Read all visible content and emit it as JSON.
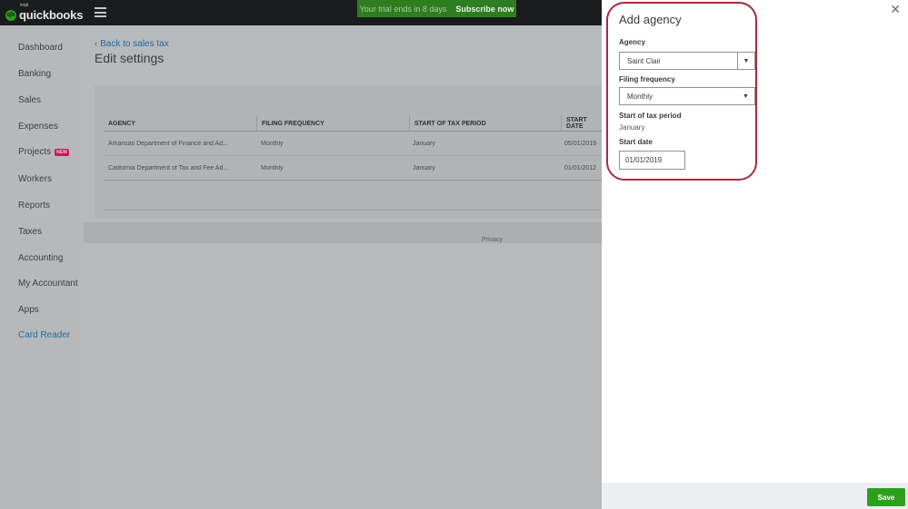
{
  "topbar": {
    "brand_small": "intuit",
    "brand": "quickbooks",
    "trial_text": "Your trial ends in 8 days",
    "subscribe_label": "Subscribe now"
  },
  "sidebar": {
    "items": [
      {
        "label": "Dashboard"
      },
      {
        "label": "Banking"
      },
      {
        "label": "Sales"
      },
      {
        "label": "Expenses"
      },
      {
        "label": "Projects",
        "badge": "NEW"
      },
      {
        "label": "Workers"
      },
      {
        "label": "Reports"
      },
      {
        "label": "Taxes"
      },
      {
        "label": "Accounting"
      },
      {
        "label": "My Accountant"
      },
      {
        "label": "Apps"
      },
      {
        "label": "Card Reader"
      }
    ]
  },
  "main": {
    "back_link": "Back to sales tax",
    "title": "Edit settings",
    "table": {
      "headers": [
        "AGENCY",
        "FILING FREQUENCY",
        "START OF TAX PERIOD",
        "START DATE"
      ],
      "rows": [
        [
          "Arkansas Department of Finance and Ad...",
          "Monthly",
          "January",
          "05/01/2019"
        ],
        [
          "California Department of Tax and Fee Ad...",
          "Monthly",
          "January",
          "01/01/2012"
        ]
      ]
    },
    "footer_link": "Privacy"
  },
  "panel": {
    "title": "Add agency",
    "agency_label": "Agency",
    "agency_value": "Saint Clair",
    "frequency_label": "Filing frequency",
    "frequency_value": "Monthly",
    "tax_period_label": "Start of tax period",
    "tax_period_value": "January",
    "start_date_label": "Start date",
    "start_date_value": "01/01/2019",
    "close_glyph": "✕",
    "save_label": "Save"
  },
  "colors": {
    "brand_green": "#2ca01c",
    "highlight": "#a52b3f",
    "link": "#236a9e"
  }
}
